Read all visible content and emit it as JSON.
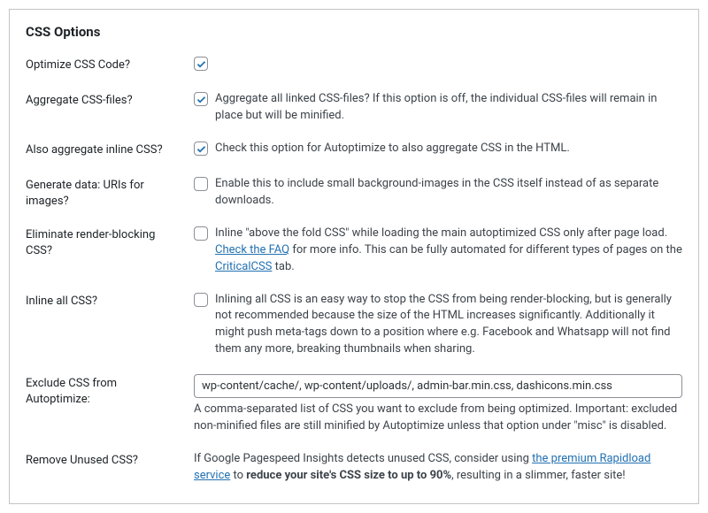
{
  "title": "CSS Options",
  "rows": {
    "optimize": {
      "label": "Optimize CSS Code?",
      "checked": true
    },
    "aggregate": {
      "label": "Aggregate CSS-files?",
      "checked": true,
      "desc": "Aggregate all linked CSS-files? If this option is off, the individual CSS-files will remain in place but will be minified."
    },
    "inlineAggregate": {
      "label": "Also aggregate inline CSS?",
      "checked": true,
      "desc": "Check this option for Autoptimize to also aggregate CSS in the HTML."
    },
    "dataUri": {
      "label": "Generate data: URIs for images?",
      "checked": false,
      "desc": "Enable this to include small background-images in the CSS itself instead of as separate downloads."
    },
    "renderBlock": {
      "label": "Eliminate render-blocking CSS?",
      "checked": false,
      "desc_before": "Inline \"above the fold CSS\" while loading the main autoptimized CSS only after page load. ",
      "link1": "Check the FAQ",
      "desc_mid": " for more info. This can be fully automated for different types of pages on the ",
      "link2": "CriticalCSS",
      "desc_after": " tab."
    },
    "inlineAll": {
      "label": "Inline all CSS?",
      "checked": false,
      "desc": "Inlining all CSS is an easy way to stop the CSS from being render-blocking, but is generally not recommended because the size of the HTML increases significantly. Additionally it might push meta-tags down to a position where e.g. Facebook and Whatsapp will not find them any more, breaking thumbnails when sharing."
    },
    "exclude": {
      "label": "Exclude CSS from Autoptimize:",
      "value": "wp-content/cache/, wp-content/uploads/, admin-bar.min.css, dashicons.min.css",
      "helper": "A comma-separated list of CSS you want to exclude from being optimized. Important: excluded non-minified files are still minified by Autoptimize unless that option under \"misc\" is disabled."
    },
    "removeUnused": {
      "label": "Remove Unused CSS?",
      "desc_before": "If Google Pagespeed Insights detects unused CSS, consider using ",
      "link": "the premium Rapidload service",
      "desc_mid": " to ",
      "bold": "reduce your site's CSS size to up to 90%",
      "desc_after": ", resulting in a slimmer, faster site!"
    }
  }
}
